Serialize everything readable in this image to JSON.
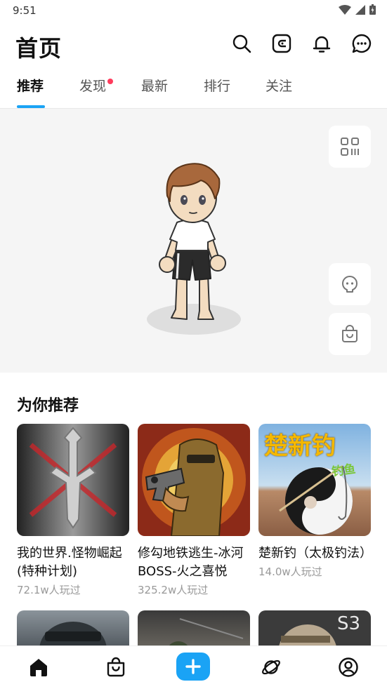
{
  "status_bar": {
    "time": "9:51"
  },
  "header": {
    "title": "首页"
  },
  "tabs": [
    {
      "label": "推荐",
      "active": true
    },
    {
      "label": "发现",
      "badge": true
    },
    {
      "label": "最新"
    },
    {
      "label": "排行"
    },
    {
      "label": "关注"
    }
  ],
  "recommend": {
    "title": "为你推荐",
    "items": [
      {
        "title": "我的世界.怪物崛起(特种计划)",
        "plays": "72.1w人玩过"
      },
      {
        "title": "修勾地铁逃生-冰河BOSS-火之喜悦",
        "plays": "325.2w人玩过"
      },
      {
        "title": "楚新钓（太极钓法）",
        "plays": "14.0w人玩过"
      }
    ],
    "thumb3_text": "楚新钓",
    "thumb3_subtext": "钓鱼",
    "thumb6_text": "S3"
  },
  "colors": {
    "accent": "#1aa3f5",
    "badge": "#ff3b5c"
  },
  "icons": {
    "header": [
      "search-icon",
      "wallet-icon",
      "bell-icon",
      "chat-icon"
    ],
    "side": [
      "qr-code-icon",
      "face-icon",
      "shop-bag-icon"
    ],
    "nav": [
      "home-icon",
      "bag-icon",
      "plus-icon",
      "planet-icon",
      "profile-icon"
    ]
  }
}
